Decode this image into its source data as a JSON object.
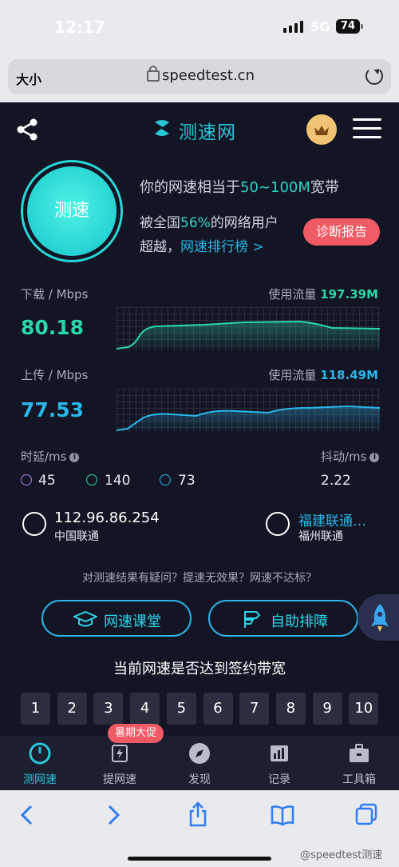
{
  "status_bar": {
    "time": "12:17",
    "network": "5G",
    "battery": "74"
  },
  "browser": {
    "text_size_label": "大小",
    "url": "speedtest.cn"
  },
  "header": {
    "logo_text": "测速网"
  },
  "speed": {
    "button_label": "测速",
    "equivalent_prefix": "你的网速相当于",
    "equivalent_value": "50~100M",
    "equivalent_suffix": "宽带",
    "beat_prefix": "被全国",
    "beat_percent": "56%",
    "beat_suffix": "的网络用户",
    "beat_line2": "超越，",
    "ranking_link": "网速排行榜 >",
    "diagnose_button": "诊断报告"
  },
  "download": {
    "label": "下载 / Mbps",
    "value": "80.18",
    "flow_label": "使用流量",
    "flow_value": "197.39M"
  },
  "upload": {
    "label": "上传 / Mbps",
    "value": "77.53",
    "flow_label": "使用流量",
    "flow_value": "118.49M"
  },
  "latency": {
    "label": "时延/ms",
    "idle": "45",
    "down": "140",
    "up": "73"
  },
  "jitter": {
    "label": "抖动/ms",
    "value": "2.22"
  },
  "client": {
    "ip": "112.96.86.254",
    "isp": "中国联通"
  },
  "server": {
    "name": "福建联通…",
    "city": "福州联通"
  },
  "question_text": "对测速结果有疑问？提速无效果？网速不达标？",
  "pills": {
    "left": "网速课堂",
    "right": "自助排障"
  },
  "survey": {
    "title": "当前网速是否达到签约带宽",
    "options": [
      "1",
      "2",
      "3",
      "4",
      "5",
      "6",
      "7",
      "8",
      "9",
      "10"
    ]
  },
  "tabs": [
    {
      "label": "测网速",
      "icon": "speedometer-icon"
    },
    {
      "label": "提网速",
      "icon": "chip-bolt-icon"
    },
    {
      "label": "发现",
      "icon": "compass-icon"
    },
    {
      "label": "记录",
      "icon": "chart-icon"
    },
    {
      "label": "工具箱",
      "icon": "toolbox-icon"
    }
  ],
  "promo_badge": "暑期大促",
  "watermark": "@speedtest测速",
  "colors": {
    "accent_teal": "#27c6d8",
    "green": "#2ad6a6",
    "blue": "#2ab6e8",
    "red": "#ef5a64",
    "bg": "#131524"
  }
}
